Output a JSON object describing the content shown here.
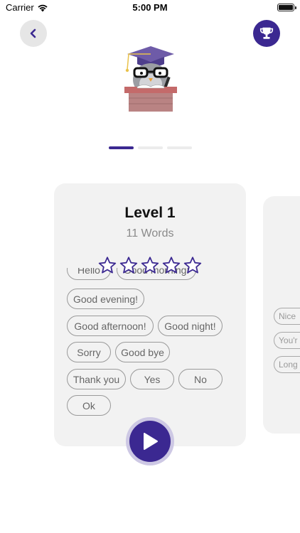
{
  "status_bar": {
    "carrier": "Carrier",
    "time": "5:00 PM"
  },
  "header": {
    "back_icon": "chevron-left-icon",
    "trophy_icon": "trophy-icon"
  },
  "pager": {
    "total": 3,
    "active": 0
  },
  "level_card": {
    "title": "Level 1",
    "subtitle": "11 Words",
    "rating": {
      "filled": 0,
      "max": 5
    },
    "words": [
      "Hello",
      "Good morning!",
      "Good evening!",
      "Good afternoon!",
      "Good night!",
      "Sorry",
      "Good bye",
      "Thank you",
      "Yes",
      "No",
      "Ok"
    ]
  },
  "next_card": {
    "words_partial": [
      "Nice",
      "You'r",
      "Long"
    ]
  },
  "colors": {
    "accent": "#3b2891",
    "accent_light": "#cdc8e4",
    "card_bg": "#f2f2f2",
    "chip_border": "#9a9a9a",
    "chip_text": "#666666"
  },
  "play_icon": "play-icon"
}
